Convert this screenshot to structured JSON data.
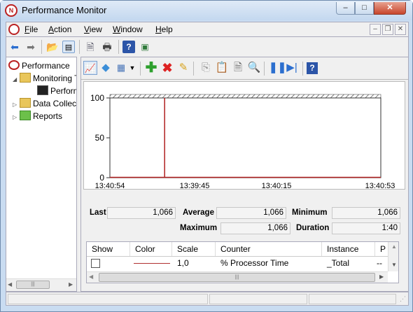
{
  "window": {
    "title": "Performance Monitor",
    "min": "–",
    "max": "□",
    "close": "✕"
  },
  "menu": [
    {
      "label": "File",
      "key": "F",
      "rest": "ile"
    },
    {
      "label": "Action",
      "key": "A",
      "rest": "ction"
    },
    {
      "label": "View",
      "key": "V",
      "rest": "iew"
    },
    {
      "label": "Window",
      "key": "W",
      "rest": "indow"
    },
    {
      "label": "Help",
      "key": "H",
      "rest": "elp"
    }
  ],
  "mdi": {
    "min": "–",
    "restore": "❐",
    "close": "✕"
  },
  "tree": {
    "root": "Performance",
    "monitoring": "Monitoring Tools",
    "perfmon": "Performance Monitor",
    "dcs": "Data Collector Sets",
    "reports": "Reports"
  },
  "graph": {
    "y_max": "100",
    "y_mid": "50",
    "y_min": "0",
    "x_start": "13:40:54",
    "x_mid1": "13:39:45",
    "x_mid2": "13:40:15",
    "x_end": "13:40:53"
  },
  "stats": {
    "last_label": "Last",
    "last": "1,066",
    "average_label": "Average",
    "average": "1,066",
    "minimum_label": "Minimum",
    "minimum": "1,066",
    "maximum_label": "Maximum",
    "maximum": "1,066",
    "duration_label": "Duration",
    "duration": "1:40"
  },
  "legend": {
    "headers": {
      "show": "Show",
      "color": "Color",
      "scale": "Scale",
      "counter": "Counter",
      "instance": "Instance",
      "parent": "P"
    },
    "row": {
      "scale": "1,0",
      "counter": "% Processor Time",
      "instance": "_Total",
      "parent": "--",
      "color": "#b03030"
    }
  },
  "colors": {
    "line": "#b02020",
    "accent": "#c9dcf1"
  },
  "chart_data": {
    "type": "line",
    "title": "",
    "xlabel": "",
    "ylabel": "",
    "ylim": [
      0,
      100
    ],
    "x_ticks": [
      "13:40:54",
      "13:39:45",
      "13:40:15",
      "13:40:53"
    ],
    "series": [
      {
        "name": "% Processor Time",
        "values": [
          0,
          0,
          0,
          0,
          0,
          0,
          0,
          0,
          0,
          0,
          0,
          0,
          0,
          0,
          0,
          0,
          0,
          0,
          0,
          0,
          0,
          0,
          0,
          0,
          0,
          0,
          0,
          0,
          0,
          0,
          0,
          0,
          0,
          0,
          0,
          0,
          0,
          0,
          0,
          0,
          0,
          0,
          0,
          0,
          0,
          0,
          0,
          0,
          0,
          0,
          0,
          0,
          0,
          0,
          0,
          0,
          0,
          0,
          0,
          0,
          0,
          0,
          0,
          0,
          0,
          0,
          0,
          0,
          0,
          0,
          0,
          0,
          0,
          0,
          0,
          0,
          0,
          0,
          0,
          0,
          0,
          0,
          0,
          0,
          0,
          0,
          0,
          0,
          0,
          0,
          0,
          0,
          0,
          0,
          0,
          0,
          0,
          0,
          0,
          0
        ]
      }
    ],
    "current_sample_index": 20,
    "grid": false
  }
}
